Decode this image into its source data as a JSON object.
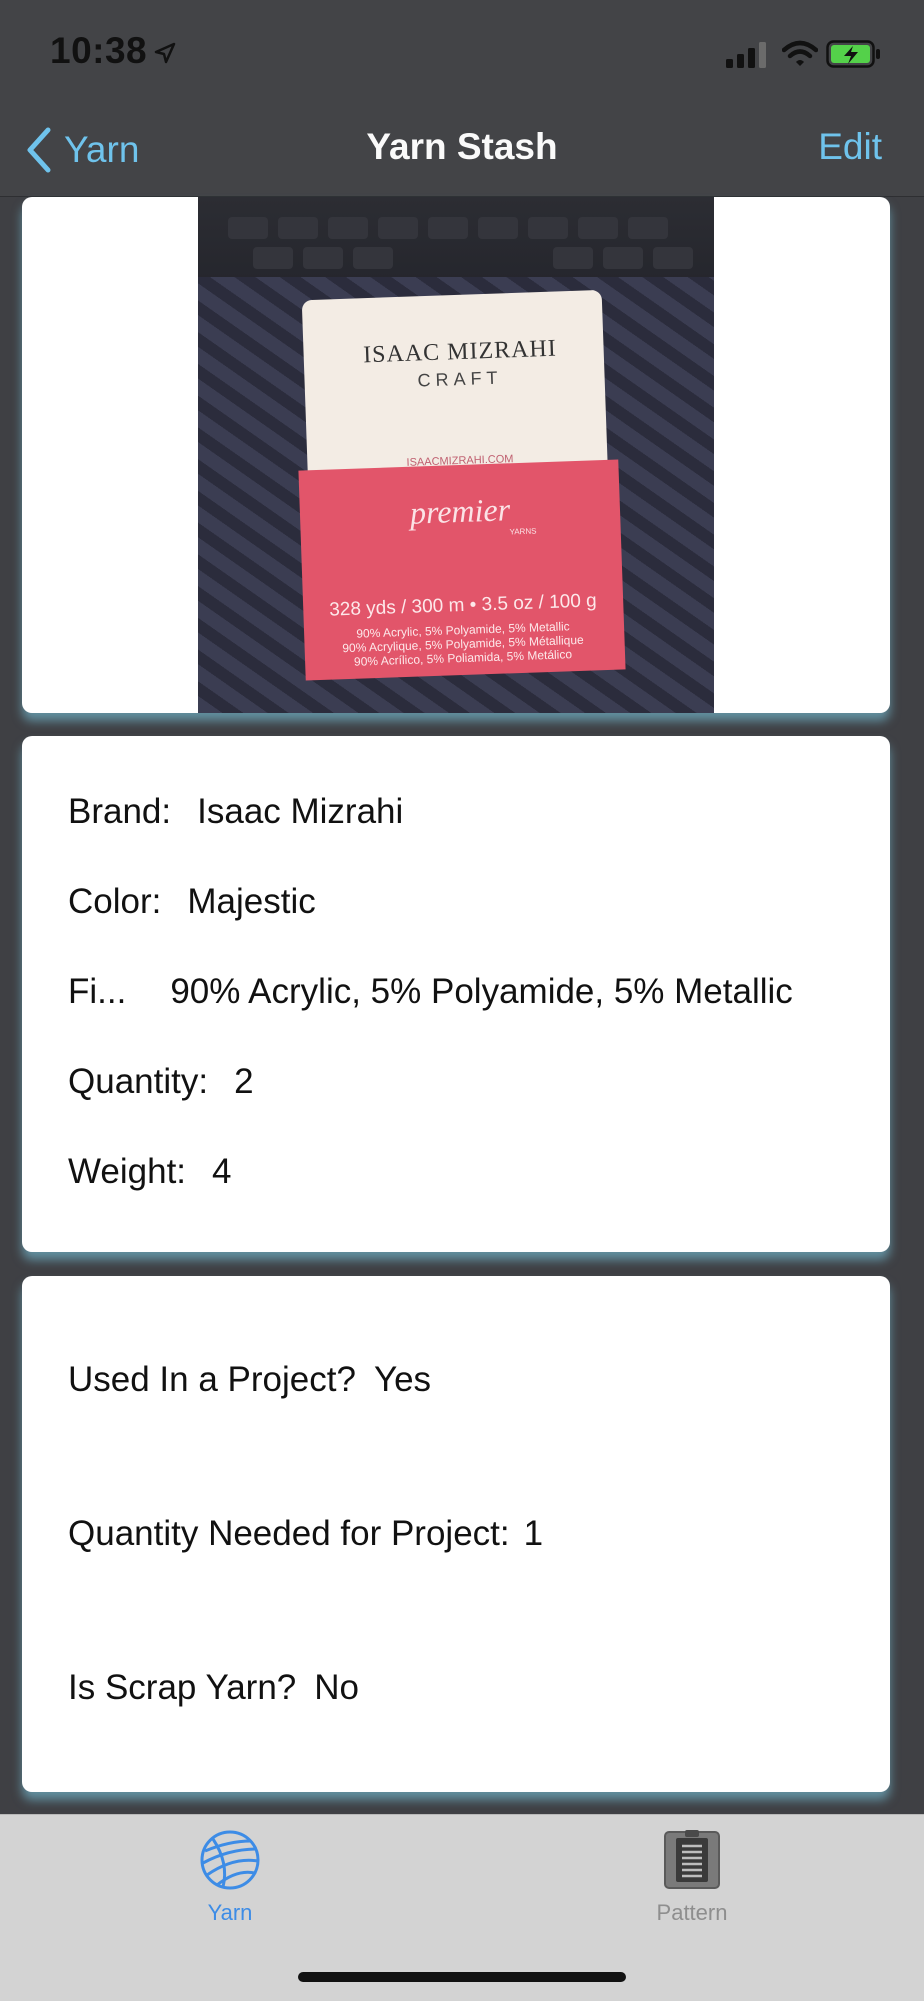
{
  "status_bar": {
    "time": "10:38",
    "icons": [
      "location-arrow-icon",
      "cellular-signal-icon",
      "wifi-icon",
      "battery-charging-icon"
    ]
  },
  "nav": {
    "back_label": "Yarn",
    "title": "Yarn Stash",
    "edit_label": "Edit"
  },
  "photo": {
    "label_brand": "ISAAC MIZRAHI",
    "label_craft": "CRAFT",
    "label_url": "ISAACMIZRAHI.COM",
    "label_premier": "premier",
    "label_yarns": "YARNS",
    "label_weight": "328 yds / 300 m • 3.5 oz / 100 g",
    "label_fiber_1": "90% Acrylic, 5% Polyamide, 5% Metallic",
    "label_fiber_2": "90% Acrylique, 5% Polyamide, 5% Métallique",
    "label_fiber_3": "90% Acrílico, 5% Poliamida, 5% Metálico"
  },
  "details": {
    "brand_label": "Brand:",
    "brand_value": "Isaac Mizrahi",
    "color_label": "Color:",
    "color_value": "Majestic",
    "fiber_label": "Fi...",
    "fiber_value": "90% Acrylic, 5% Polyamide, 5% Metallic",
    "quantity_label": "Quantity:",
    "quantity_value": "2",
    "weight_label": "Weight:",
    "weight_value": "4"
  },
  "usage": {
    "used_label": "Used In a Project?",
    "used_value": "Yes",
    "needed_label": "Quantity Needed for Project:",
    "needed_value": "1",
    "scrap_label": "Is Scrap Yarn?",
    "scrap_value": "No"
  },
  "tabs": [
    {
      "label": "Yarn",
      "icon": "yarn-ball-icon",
      "selected": true
    },
    {
      "label": "Pattern",
      "icon": "pattern-clipboard-icon",
      "selected": false
    }
  ],
  "colors": {
    "accent": "#6fc3ec",
    "tab_selected": "#3d8ce6",
    "tab_unselected": "#8e8e8e",
    "nav_background": "#434447"
  }
}
